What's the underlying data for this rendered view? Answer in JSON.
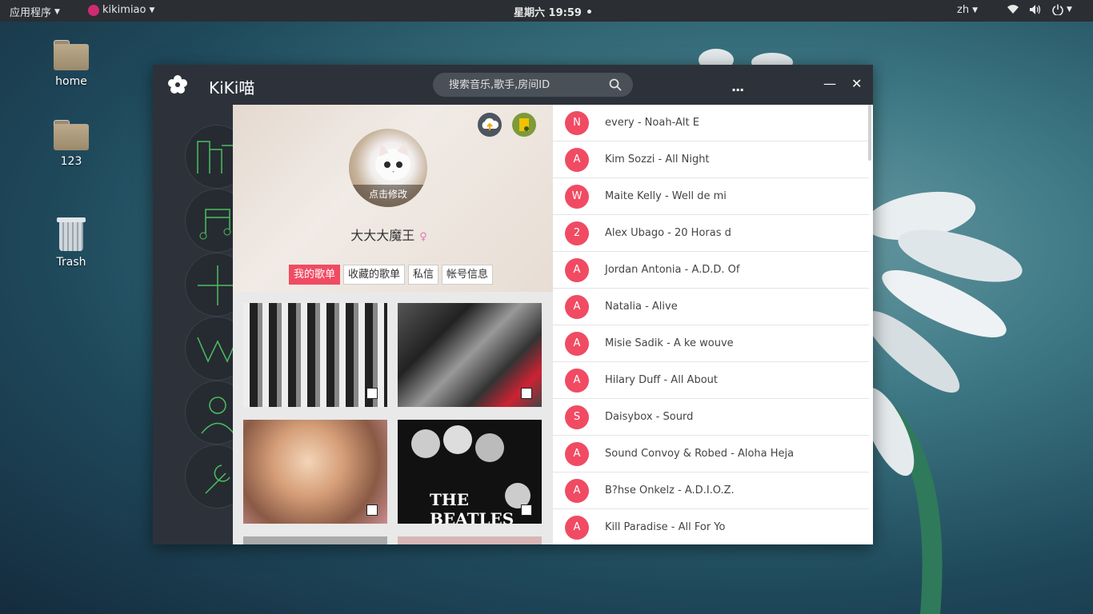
{
  "topbar": {
    "apps_label": "应用程序",
    "user_label": "kikimiao",
    "clock": "星期六 19:59",
    "lang": "zh"
  },
  "desktop": {
    "icons": [
      {
        "label": "home"
      },
      {
        "label": "123"
      },
      {
        "label": "Trash"
      }
    ]
  },
  "app": {
    "title": "KiKi喵",
    "search_placeholder": "搜索音乐,歌手,房间ID",
    "more_label": "...",
    "minimize_label": "—",
    "close_label": "✕"
  },
  "profile": {
    "avatar_caption": "点击修改",
    "username": "大大大魔王",
    "gender_icon": "female-icon",
    "tabs": [
      {
        "label": "我的歌单",
        "active": true
      },
      {
        "label": "收藏的歌单",
        "active": false
      },
      {
        "label": "私信",
        "active": false
      },
      {
        "label": "帐号信息",
        "active": false
      }
    ]
  },
  "playlists": [
    {
      "cover": "group-photo-girls",
      "bg": "#7a7a7a"
    },
    {
      "cover": "collage-portraits",
      "bg": "#3a3a3a"
    },
    {
      "cover": "actress-portrait",
      "bg": "#c9a27f"
    },
    {
      "cover": "beatles-album",
      "bg": "#111111",
      "text": "THE BEATLES"
    }
  ],
  "songs": [
    {
      "badge": "N",
      "title": "every - Noah-Alt E"
    },
    {
      "badge": "A",
      "title": "Kim Sozzi - All Night"
    },
    {
      "badge": "W",
      "title": "Maite Kelly - Well de mi"
    },
    {
      "badge": "2",
      "title": "Alex Ubago - 20 Horas d"
    },
    {
      "badge": "A",
      "title": "Jordan Antonia - A.D.D. Of"
    },
    {
      "badge": "A",
      "title": "Natalia - Alive"
    },
    {
      "badge": "A",
      "title": "Misie Sadik - A ke wouve"
    },
    {
      "badge": "A",
      "title": "Hilary Duff - All About"
    },
    {
      "badge": "S",
      "title": "Daisybox - Sourd"
    },
    {
      "badge": "A",
      "title": "Sound Convoy & Robed - Aloha Heja"
    },
    {
      "badge": "A",
      "title": "B?hse Onkelz - A.D.I.O.Z."
    },
    {
      "badge": "A",
      "title": "Kill Paradise - All For Yo"
    }
  ],
  "colors": {
    "accent": "#f04b63",
    "window_bg": "#2d323a",
    "panel_bg": "#2b2e33"
  }
}
